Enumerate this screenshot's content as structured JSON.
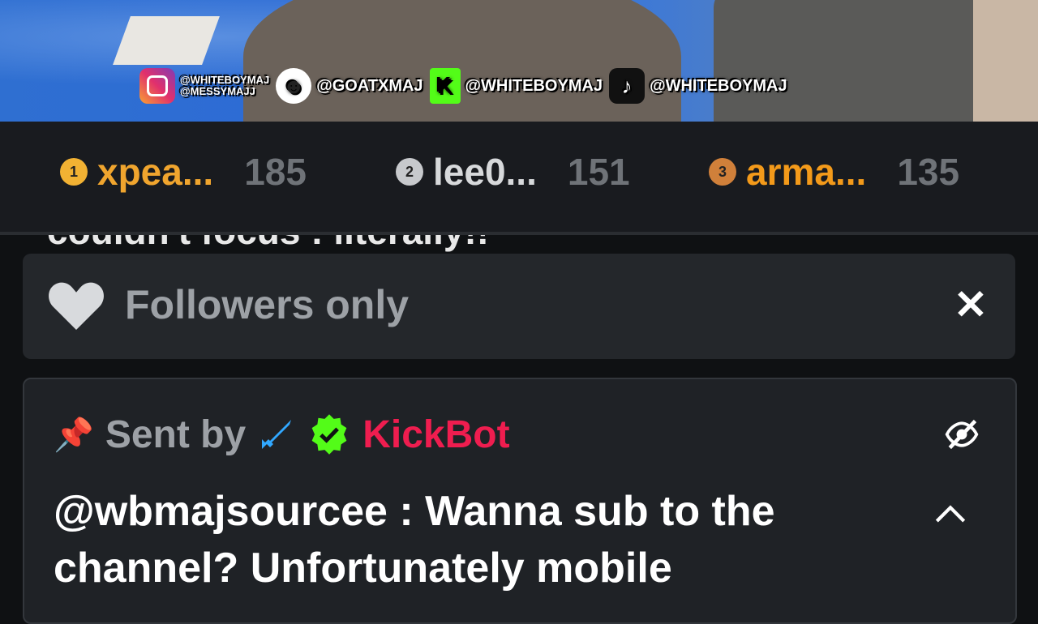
{
  "video": {
    "socials": [
      {
        "icon": "instagram-icon",
        "lines": [
          "@WHITEBOYMAJ",
          "@MESSYMAJJ"
        ]
      },
      {
        "icon": "ghost-icon",
        "text": "@GOATXMAJ"
      },
      {
        "icon": "kick-icon",
        "text": "@WHITEBOYMAJ"
      },
      {
        "icon": "tiktok-icon",
        "text": "@WHITEBOYMAJ"
      }
    ]
  },
  "leaderboard": [
    {
      "rank": "1",
      "name": "xpea...",
      "score": "185",
      "color": "#f0a52e",
      "medal_color": "#f2b233"
    },
    {
      "rank": "2",
      "name": "lee0...",
      "score": "151",
      "color": "#d7d9db",
      "medal_color": "#c7c9cc"
    },
    {
      "rank": "3",
      "name": "arma...",
      "score": "135",
      "color": "#f39a1a",
      "medal_color": "#d0803a"
    }
  ],
  "chat_partial_text": "couldn't focus : literally!!",
  "followers_only": {
    "label": "Followers only"
  },
  "pinned": {
    "sent_by_label": "Sent by",
    "username": "KickBot",
    "username_color": "#ef1d4f",
    "message": "@wbmajsourcee : Wanna sub to the channel? Unfortunately mobile"
  }
}
